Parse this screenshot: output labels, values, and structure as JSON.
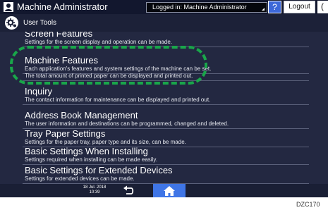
{
  "header": {
    "title": "Machine Administrator",
    "login_status": "Logged in: Machine Administrator",
    "help_label": "?",
    "logout_label": "Logout",
    "power_label": "("
  },
  "subheader": {
    "title": "User Tools"
  },
  "menu": {
    "items": [
      {
        "title": "Screen Features",
        "description": "Settings for the screen display and operation can be made."
      },
      {
        "title": "Machine Features",
        "description": "Each application's features and system settings of the machine can be set."
      },
      {
        "title": "",
        "description": "The total amount of printed paper can be displayed and printed out."
      },
      {
        "title": "Inquiry",
        "description": "The contact information for maintenance can be displayed and printed out."
      },
      {
        "title": "Address Book Management",
        "description": "The user information and destinations can be programmed, changed and deleted."
      },
      {
        "title": "Tray Paper Settings",
        "description": "Settings for the paper tray, paper type and its size, can be made."
      },
      {
        "title": "Basic Settings When Installing",
        "description": "Settings required when installing can be made easily."
      },
      {
        "title": "Basic Settings for Extended Devices",
        "description": "Settings for extended devices can be made."
      }
    ]
  },
  "footer": {
    "date": "18 Jul. 2018",
    "time": "10:39"
  },
  "figure_code": "DZC170",
  "colors": {
    "menu_background": "#232841",
    "highlight": "#19a64a",
    "home_button": "#3f75e6"
  }
}
